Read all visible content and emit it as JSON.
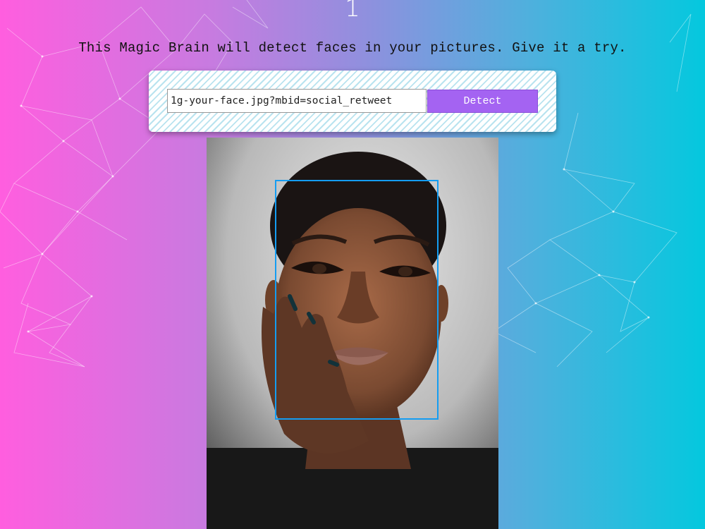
{
  "header": {
    "entry_count": "1",
    "intro_text": "This Magic Brain will detect faces in your pictures. Give it a try."
  },
  "form": {
    "url_value": "1g-your-face.jpg?mbid=social_retweet",
    "detect_label": "Detect"
  },
  "result": {
    "image_alt": "portrait photo",
    "face_box_color": "#149df2"
  },
  "colors": {
    "gradient_left": "#ff5edf",
    "gradient_right": "#04c8de",
    "button": "#a463f2"
  }
}
